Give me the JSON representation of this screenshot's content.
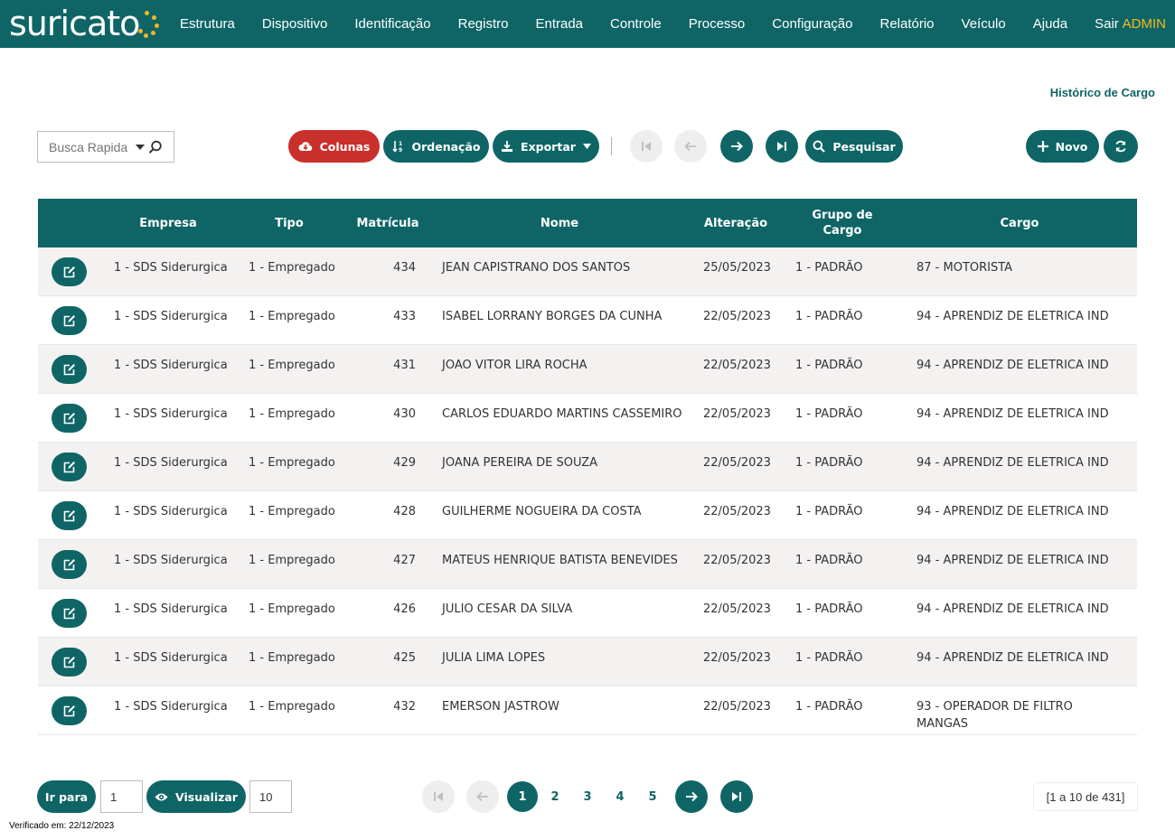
{
  "app": {
    "logo_text": "suricato",
    "nav": [
      "Estrutura",
      "Dispositivo",
      "Identificação",
      "Registro",
      "Entrada",
      "Controle",
      "Processo",
      "Configuração",
      "Relatório",
      "Veículo",
      "Ajuda",
      "Sair"
    ],
    "user": "ADMIN",
    "colors": {
      "primary": "#0f6566",
      "accent": "#f2b821",
      "danger": "#c9302c"
    }
  },
  "page": {
    "title": "Histórico de Cargo"
  },
  "toolbar": {
    "search_placeholder": "Busca Rapida",
    "columns_label": "Colunas",
    "sort_label": "Ordenação",
    "export_label": "Exportar",
    "search_label": "Pesquisar",
    "new_label": "Novo"
  },
  "table": {
    "headers": {
      "empresa": "Empresa",
      "tipo": "Tipo",
      "matricula": "Matrícula",
      "nome": "Nome",
      "alteracao": "Alteração",
      "grupo_line1": "Grupo de",
      "grupo_line2": "Cargo",
      "cargo": "Cargo"
    },
    "rows": [
      {
        "empresa": "1 - SDS Siderurgica",
        "tipo": "1 - Empregado",
        "matricula": "434",
        "nome": "JEAN CAPISTRANO DOS SANTOS",
        "alteracao": "25/05/2023",
        "grupo": "1 - PADRÃO",
        "cargo": "87 - MOTORISTA"
      },
      {
        "empresa": "1 - SDS Siderurgica",
        "tipo": "1 - Empregado",
        "matricula": "433",
        "nome": "ISABEL LORRANY BORGES DA CUNHA",
        "alteracao": "22/05/2023",
        "grupo": "1 - PADRÃO",
        "cargo": "94 - APRENDIZ DE ELETRICA IND"
      },
      {
        "empresa": "1 - SDS Siderurgica",
        "tipo": "1 - Empregado",
        "matricula": "431",
        "nome": "JOAO VITOR LIRA ROCHA",
        "alteracao": "22/05/2023",
        "grupo": "1 - PADRÃO",
        "cargo": "94 - APRENDIZ DE ELETRICA IND"
      },
      {
        "empresa": "1 - SDS Siderurgica",
        "tipo": "1 - Empregado",
        "matricula": "430",
        "nome": "CARLOS EDUARDO MARTINS CASSEMIRO",
        "alteracao": "22/05/2023",
        "grupo": "1 - PADRÃO",
        "cargo": "94 - APRENDIZ DE ELETRICA IND"
      },
      {
        "empresa": "1 - SDS Siderurgica",
        "tipo": "1 - Empregado",
        "matricula": "429",
        "nome": "JOANA PEREIRA DE SOUZA",
        "alteracao": "22/05/2023",
        "grupo": "1 - PADRÃO",
        "cargo": "94 - APRENDIZ DE ELETRICA IND"
      },
      {
        "empresa": "1 - SDS Siderurgica",
        "tipo": "1 - Empregado",
        "matricula": "428",
        "nome": "GUILHERME NOGUEIRA DA COSTA",
        "alteracao": "22/05/2023",
        "grupo": "1 - PADRÃO",
        "cargo": "94 - APRENDIZ DE ELETRICA IND"
      },
      {
        "empresa": "1 - SDS Siderurgica",
        "tipo": "1 - Empregado",
        "matricula": "427",
        "nome": "MATEUS HENRIQUE BATISTA BENEVIDES",
        "alteracao": "22/05/2023",
        "grupo": "1 - PADRÃO",
        "cargo": "94 - APRENDIZ DE ELETRICA IND"
      },
      {
        "empresa": "1 - SDS Siderurgica",
        "tipo": "1 - Empregado",
        "matricula": "426",
        "nome": "JULIO CESAR DA SILVA",
        "alteracao": "22/05/2023",
        "grupo": "1 - PADRÃO",
        "cargo": "94 - APRENDIZ DE ELETRICA IND"
      },
      {
        "empresa": "1 - SDS Siderurgica",
        "tipo": "1 - Empregado",
        "matricula": "425",
        "nome": "JULIA LIMA LOPES",
        "alteracao": "22/05/2023",
        "grupo": "1 - PADRÃO",
        "cargo": "94 - APRENDIZ DE ELETRICA IND"
      },
      {
        "empresa": "1 - SDS Siderurgica",
        "tipo": "1 - Empregado",
        "matricula": "432",
        "nome": "EMERSON JASTROW",
        "alteracao": "22/05/2023",
        "grupo": "1 - PADRÃO",
        "cargo": "93 - OPERADOR DE FILTRO MANGAS"
      }
    ]
  },
  "footer": {
    "goto_label": "Ir para",
    "goto_value": "1",
    "view_label": "Visualizar",
    "view_value": "10",
    "pages": [
      "1",
      "2",
      "3",
      "4",
      "5"
    ],
    "range_text": "[1 a 10 de 431]",
    "verified_text": "Verificado em: 22/12/2023"
  }
}
